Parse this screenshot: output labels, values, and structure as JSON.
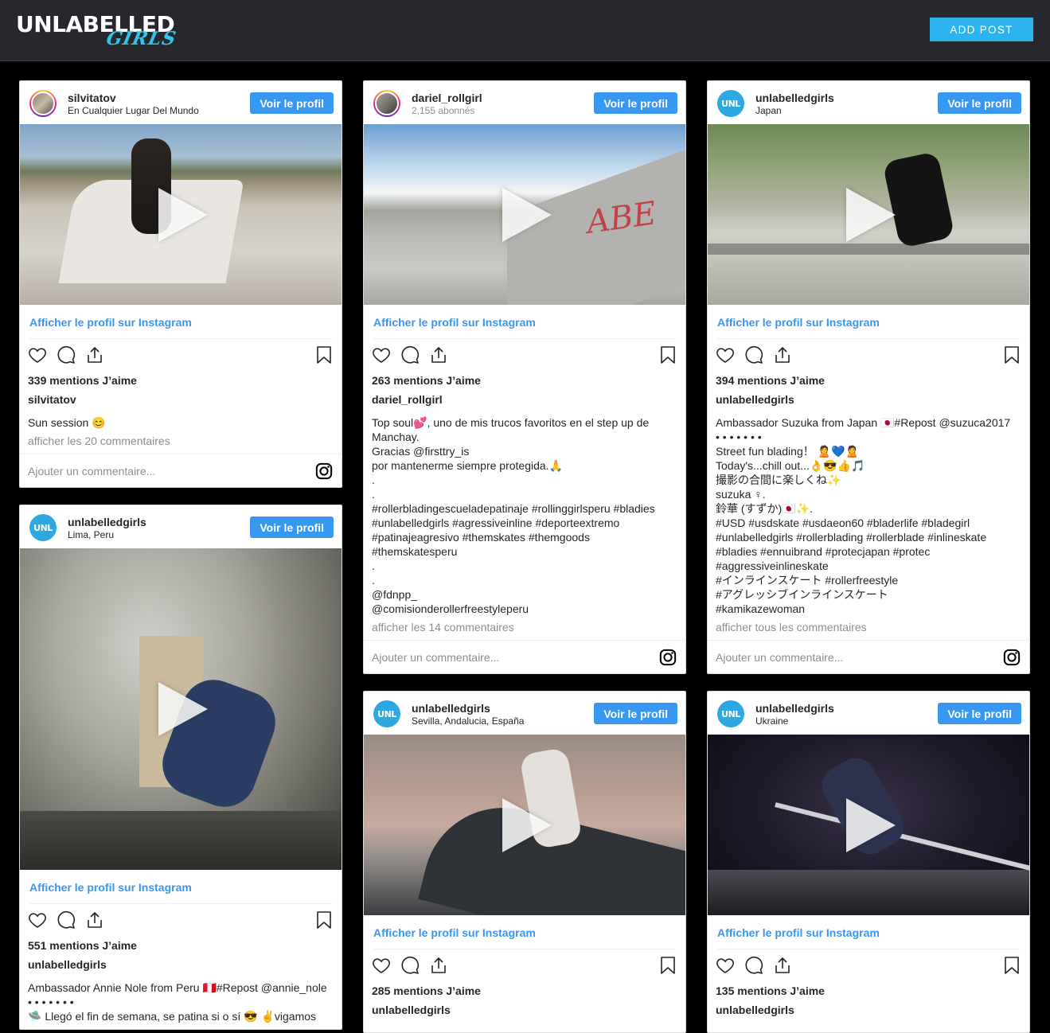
{
  "header": {
    "logo_main": "UNLABELLED",
    "logo_sub": "GIRLS",
    "add_post_label": "ADD POST"
  },
  "common": {
    "voir_label": "Voir le profil",
    "ig_link_label": "Afficher le profil sur Instagram",
    "comment_placeholder": "Ajouter un commentaire..."
  },
  "posts": [
    {
      "username": "silvitatov",
      "location": "En Cualquier Lugar Del Mundo",
      "likes": "339 mentions J’aime",
      "author": "silvitatov",
      "caption": "Sun session 😊",
      "comments_link": "afficher les 20 commentaires"
    },
    {
      "username": "dariel_rollgirl",
      "location": "2,155 abonnés",
      "likes": "263 mentions J’aime",
      "author": "dariel_rollgirl",
      "caption": "Top soul💕, uno de mis trucos favoritos en el step up de Manchay.\nGracias @firsttry_is\npor mantenerme siempre protegida.🙏\n.\n.\n#rollerbladingescueladepatinaje #rollinggirlsperu #bladies #unlabelledgirls #agressiveinline #deporteextremo #patinajeagresivo #themskates #themgoods #themskatesperu\n.\n.\n@fdnpp_\n@comisionderollerfreestyleperu",
      "comments_link": "afficher les 14 commentaires"
    },
    {
      "username": "unlabelledgirls",
      "location": "Japan",
      "likes": "394 mentions J’aime",
      "author": "unlabelledgirls",
      "caption": "Ambassador Suzuka from Japan 🇯🇵#Repost @suzuca2017\n• • • • • • •\nStreet fun blading！ 🙎💙🙎\nToday's...chill out...👌😎👍🎵\n撮影の合間に楽しくね✨\nsuzuka ♀.\n鈴華 (すずか)🇯🇵✨.\n#USD #usdskate #usdaeon60 #bladerlife #bladegirl #unlabelledgirls #rollerblading #rollerblade #inlineskate #bladies #ennuibrand #protecjapan #protec #aggressiveinlineskate\n#インラインスケート #rollerfreestyle\n#アグレッシブインラインスケート\n#kamikazewoman",
      "comments_link": "afficher tous les commentaires"
    },
    {
      "username": "unlabelledgirls",
      "location": "Lima, Peru",
      "likes": "551 mentions J’aime",
      "author": "unlabelledgirls",
      "caption": "Ambassador Annie Nole from Peru 🇵🇪#Repost @annie_nole\n• • • • • • •\n🛸 Llegó el fin de semana, se patina si o sí 😎 ✌️vigamos"
    },
    {
      "username": "unlabelledgirls",
      "location": "Sevilla, Andalucia, España",
      "likes": "285 mentions J’aime",
      "author": "unlabelledgirls"
    },
    {
      "username": "unlabelledgirls",
      "location": "Ukraine",
      "likes": "135 mentions J’aime",
      "author": "unlabelledgirls"
    }
  ],
  "colors": {
    "topbar": "#26282d",
    "accent": "#2db4ee",
    "instagram_blue": "#3897f0",
    "page_bg": "#000000"
  }
}
